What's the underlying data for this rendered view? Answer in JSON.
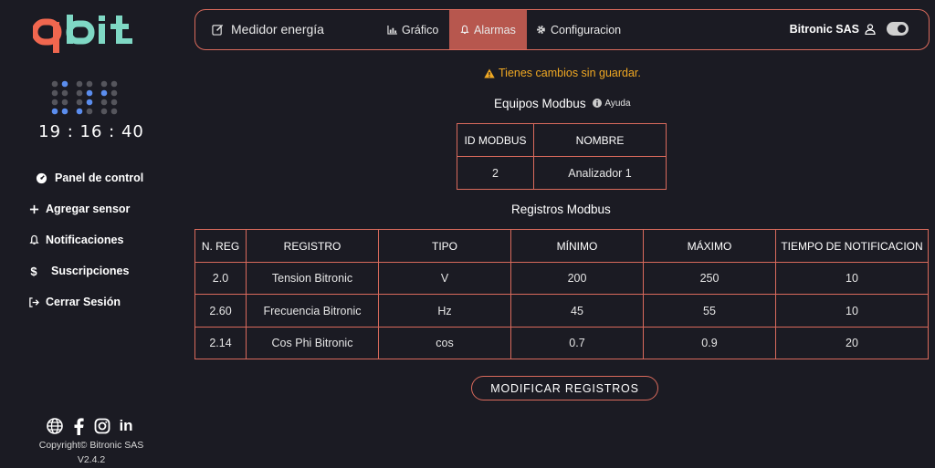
{
  "sidebar": {
    "logo_text": "qbit",
    "clock": "19 : 16 : 40",
    "nav": [
      {
        "label": "Panel de control",
        "icon": "gauge-icon"
      },
      {
        "label": "Agregar sensor",
        "icon": "plus-icon"
      },
      {
        "label": "Notificaciones",
        "icon": "bell-icon"
      },
      {
        "label": "Suscripciones",
        "icon": "dollar-icon"
      },
      {
        "label": "Cerrar Sesión",
        "icon": "sign-out-icon"
      }
    ],
    "social": [
      "globe-icon",
      "facebook-icon",
      "instagram-icon",
      "linkedin-icon"
    ],
    "copyright": "Copyright© Bitronic SAS",
    "version": "V2.4.2"
  },
  "topbar": {
    "brand": "Medidor energía",
    "tabs": [
      {
        "label": "Gráfico",
        "icon": "chart-icon",
        "active": false
      },
      {
        "label": "Alarmas",
        "icon": "bell-icon",
        "active": true
      },
      {
        "label": "Configuracion",
        "icon": "gear-icon",
        "active": false
      }
    ],
    "user": "Bitronic SAS"
  },
  "warning": "Tienes cambios sin guardar.",
  "equipos": {
    "title": "Equipos Modbus",
    "help": "Ayuda",
    "headers": [
      "ID MODBUS",
      "NOMBRE"
    ],
    "rows": [
      [
        "2",
        "Analizador 1"
      ]
    ]
  },
  "registros": {
    "title": "Registros Modbus",
    "headers": [
      "N. REG",
      "REGISTRO",
      "TIPO",
      "MÍNIMO",
      "MÁXIMO",
      "TIEMPO DE NOTIFICACION"
    ],
    "rows": [
      [
        "2.0",
        "Tension Bitronic",
        "V",
        "200",
        "250",
        "10"
      ],
      [
        "2.60",
        "Frecuencia Bitronic",
        "Hz",
        "45",
        "55",
        "10"
      ],
      [
        "2.14",
        "Cos Phi Bitronic",
        "cos",
        "0.7",
        "0.9",
        "20"
      ]
    ]
  },
  "button_label": "MODIFICAR REGISTROS",
  "colors": {
    "accent": "#d96a5c",
    "active_tab": "#b7574e",
    "logo_orange": "#f0674f",
    "logo_teal": "#7fd8c4",
    "warning": "#f0a823",
    "background": "#1b1b23"
  }
}
